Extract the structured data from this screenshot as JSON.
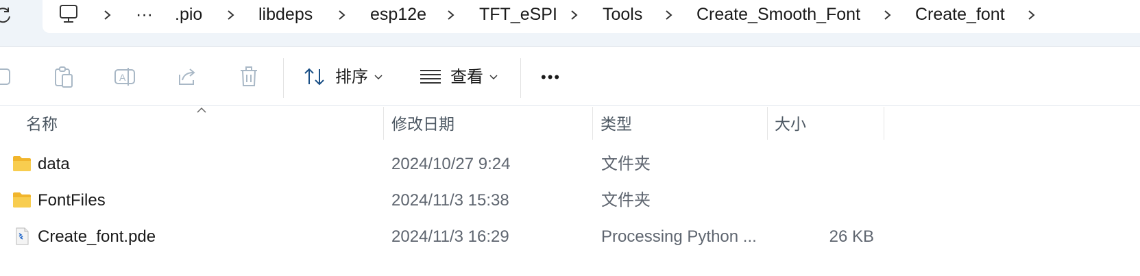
{
  "breadcrumb": {
    "overflow": "···",
    "items": [
      ".pio",
      "libdeps",
      "esp12e",
      "TFT_eSPI",
      "Tools",
      "Create_Smooth_Font",
      "Create_font"
    ]
  },
  "toolbar": {
    "sort_label": "排序",
    "view_label": "查看",
    "more_label": "•••"
  },
  "columns": {
    "name": "名称",
    "modified": "修改日期",
    "type": "类型",
    "size": "大小"
  },
  "files": [
    {
      "name": "data",
      "modified": "2024/10/27 9:24",
      "type": "文件夹",
      "size": "",
      "icon": "folder-icon"
    },
    {
      "name": "FontFiles",
      "modified": "2024/11/3 15:38",
      "type": "文件夹",
      "size": "",
      "icon": "folder-icon"
    },
    {
      "name": "Create_font.pde",
      "modified": "2024/11/3 16:29",
      "type": "Processing Python ...",
      "size": "26 KB",
      "icon": "pde-file-icon"
    }
  ],
  "colors": {
    "folder": "#f6c243",
    "accent": "#0067c0",
    "address_bg": "#eff4f9"
  }
}
